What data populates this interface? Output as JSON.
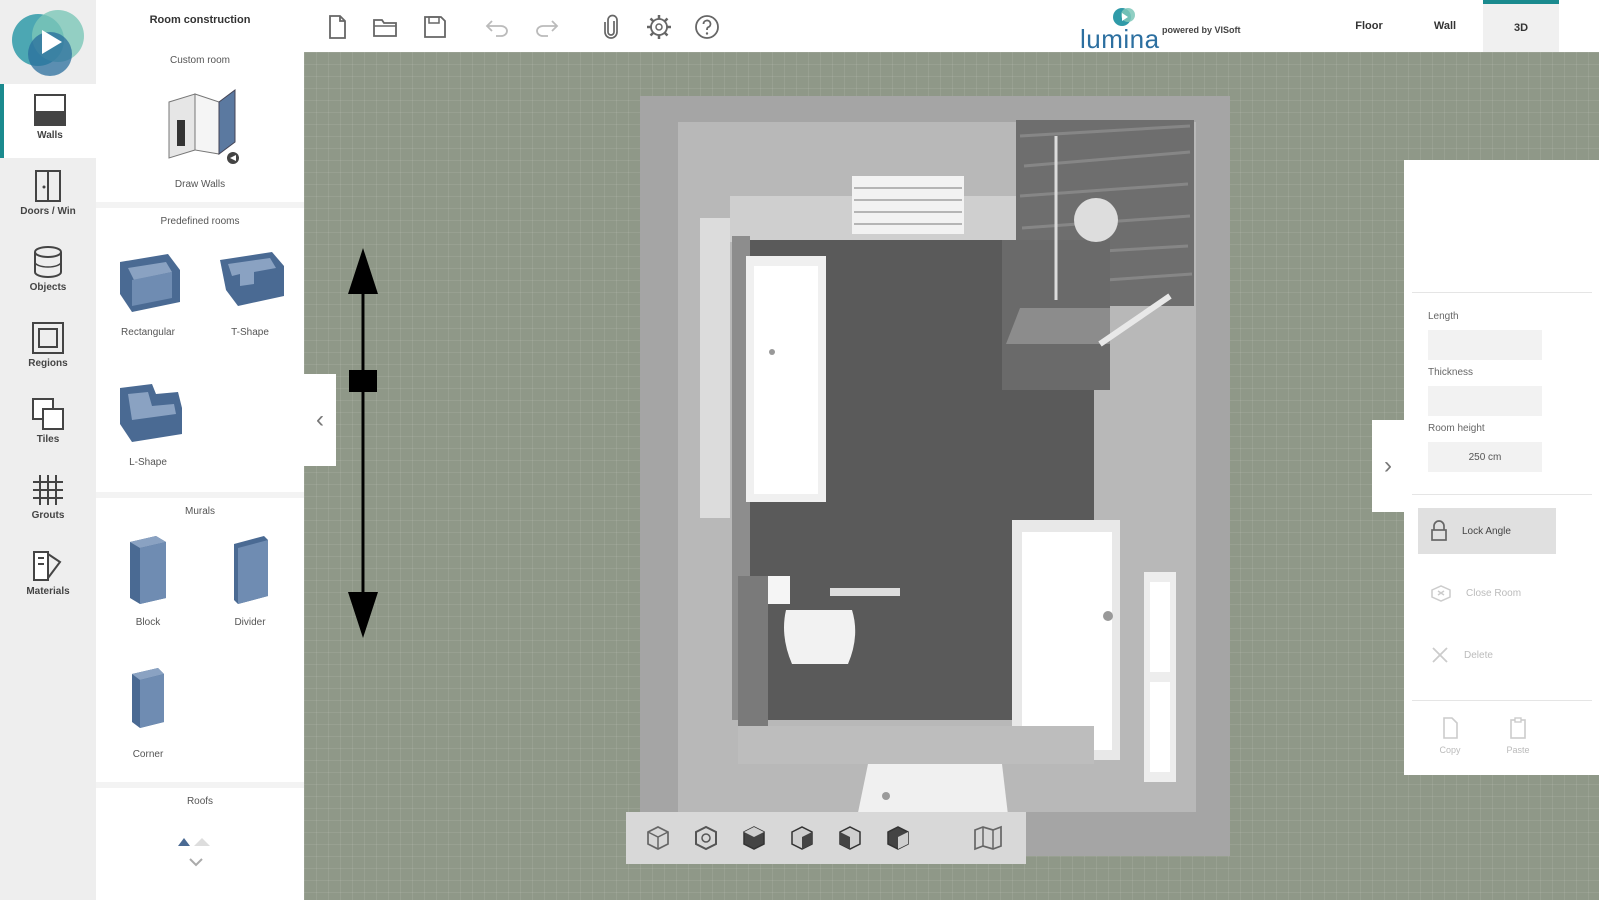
{
  "rail": {
    "items": [
      {
        "label": "Walls"
      },
      {
        "label": "Doors / Win"
      },
      {
        "label": "Objects"
      },
      {
        "label": "Regions"
      },
      {
        "label": "Tiles"
      },
      {
        "label": "Grouts"
      },
      {
        "label": "Materials"
      }
    ]
  },
  "panel": {
    "header": "Room construction",
    "custom_room": {
      "title": "Custom room",
      "draw_walls": "Draw Walls"
    },
    "predefined": {
      "title": "Predefined rooms",
      "rectangular": "Rectangular",
      "t_shape": "T-Shape",
      "l_shape": "L-Shape"
    },
    "murals": {
      "title": "Murals",
      "block": "Block",
      "divider": "Divider",
      "corner": "Corner"
    },
    "roofs": {
      "title": "Roofs"
    }
  },
  "toolbar": {
    "brand_name": "lumina",
    "powered_by": "powered by VISoft"
  },
  "view_tabs": [
    {
      "label": "Floor"
    },
    {
      "label": "Wall"
    },
    {
      "label": "3D"
    }
  ],
  "properties": {
    "length_label": "Length",
    "thickness_label": "Thickness",
    "room_height_label": "Room height",
    "room_height_value": "250 cm",
    "lock_angle": "Lock Angle",
    "close_room": "Close Room",
    "delete": "Delete",
    "copy": "Copy",
    "paste": "Paste"
  },
  "colors": {
    "accent": "#1a8a8e",
    "canvas": "#8f9888",
    "floor": "#5a5a5a"
  }
}
